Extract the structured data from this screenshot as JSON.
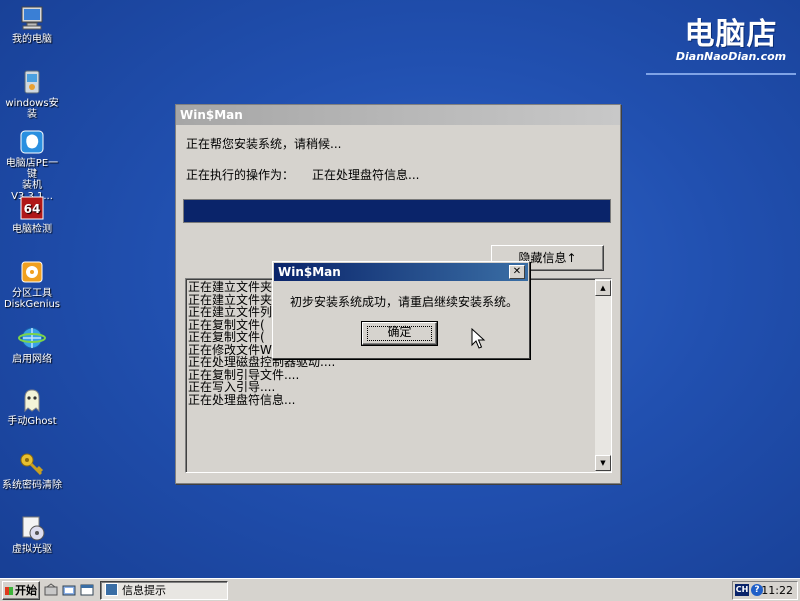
{
  "desktop": {
    "icons": [
      {
        "id": "my-computer",
        "label": "我的电脑",
        "icon": "computer-icon"
      },
      {
        "id": "windows-setup",
        "label": "windows安装",
        "icon": "setup-icon"
      },
      {
        "id": "pe-setup",
        "label": "电脑店PE一键\n装机 V3.3.1...",
        "icon": "pe-icon"
      },
      {
        "id": "pc-check",
        "label": "电脑检测",
        "icon": "64-icon"
      },
      {
        "id": "diskgenius",
        "label": "分区工具\nDiskGenius",
        "icon": "diskgenius-icon"
      },
      {
        "id": "network",
        "label": "启用网络",
        "icon": "network-icon"
      },
      {
        "id": "ghost",
        "label": "手动Ghost",
        "icon": "ghost-icon"
      },
      {
        "id": "password",
        "label": "系统密码清除",
        "icon": "key-icon"
      },
      {
        "id": "virtual-cd",
        "label": "虚拟光驱",
        "icon": "cdrom-icon"
      }
    ]
  },
  "brand": {
    "cn": "电脑店",
    "en": "DianNaoDian.com"
  },
  "main_window": {
    "title": "Win$Man",
    "status_line": "正在帮您安装系统，请稍候...",
    "current_op_label": "正在执行的操作为：",
    "current_op_value": "正在处理盘符信息...",
    "progress": 1.0,
    "hide_button": "隐藏信息↑",
    "log": [
      "正在建立文件夹",
      "正在建立文件夹",
      "正在建立文件列",
      "正在复制文件(",
      "正在复制文件(",
      "正在修改文件WI",
      "正在处理磁盘控制器驱动....",
      "正在复制引导文件....",
      "正在写入引导....",
      "正在处理盘符信息..."
    ]
  },
  "dialog": {
    "title": "Win$Man",
    "close": "✕",
    "message": "初步安装系统成功，请重启继续安装系统。",
    "ok": "确定"
  },
  "taskbar": {
    "start": "开始",
    "task_label": "信息提示",
    "ime": "CH",
    "help": "?",
    "clock": "11:22"
  },
  "colors": {
    "progress_fill": "#0a246a",
    "desktop": "#2150b0",
    "dialog_title": "#0a246a"
  }
}
